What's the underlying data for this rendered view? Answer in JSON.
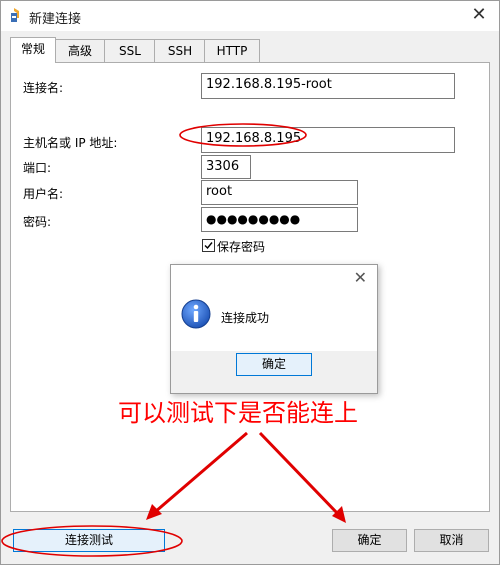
{
  "window": {
    "title": "新建连接"
  },
  "tabs": [
    {
      "label": "常规",
      "active": true
    },
    {
      "label": "高级",
      "active": false
    },
    {
      "label": "SSL",
      "active": false
    },
    {
      "label": "SSH",
      "active": false
    },
    {
      "label": "HTTP",
      "active": false
    }
  ],
  "form": {
    "connection_name_label": "连接名:",
    "connection_name_value": "192.168.8.195-root",
    "host_label": "主机名或 IP 地址:",
    "host_value": "192.168.8.195",
    "port_label": "端口:",
    "port_value": "3306",
    "username_label": "用户名:",
    "username_value": "root",
    "password_label": "密码:",
    "password_value": "●●●●●●●●●",
    "save_password_label": "保存密码",
    "save_password_checked": true
  },
  "message_box": {
    "text": "连接成功",
    "ok_label": "确定",
    "icon": "info-icon"
  },
  "annotation": {
    "text": "可以测试下是否能连上",
    "color": "#ff0000"
  },
  "footer": {
    "test_connection_label": "连接测试",
    "ok_label": "确定",
    "cancel_label": "取消"
  }
}
